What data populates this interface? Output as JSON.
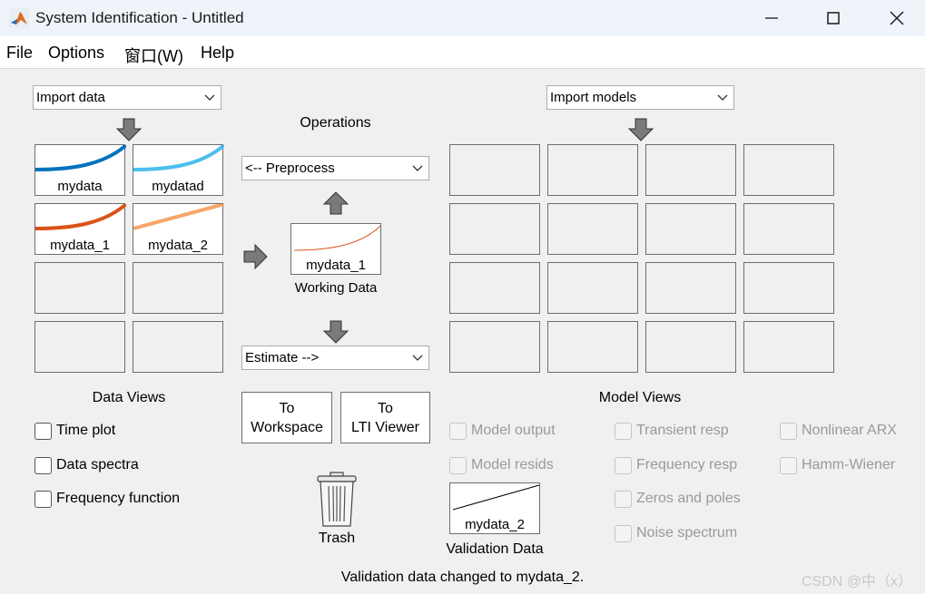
{
  "window": {
    "title": "System Identification - Untitled",
    "minimize_icon": "minimize-icon",
    "maximize_icon": "maximize-icon",
    "close_icon": "close-icon"
  },
  "menu": [
    "File",
    "Options",
    "窗口(W)",
    "Help"
  ],
  "data_panel": {
    "import_dropdown": "Import data",
    "tiles": [
      {
        "label": "mydata",
        "color": "#0072bd"
      },
      {
        "label": "mydatad",
        "color": "#4dbeee"
      },
      {
        "label": "mydata_1",
        "color": "#d95319"
      },
      {
        "label": "mydata_2",
        "color": "#f5a66a"
      }
    ],
    "section_label": "Data Views",
    "views": [
      "Time plot",
      "Data spectra",
      "Frequency function"
    ]
  },
  "operations": {
    "title": "Operations",
    "preprocess_dropdown": "<-- Preprocess",
    "working_data": {
      "label": "mydata_1",
      "caption": "Working Data",
      "color": "#d95319"
    },
    "estimate_dropdown": "Estimate -->",
    "to_workspace": [
      "To",
      "Workspace"
    ],
    "to_lti_viewer": [
      "To",
      "LTI Viewer"
    ],
    "trash_label": "Trash",
    "validation_data": {
      "label": "mydata_2",
      "caption": "Validation Data"
    }
  },
  "model_panel": {
    "import_dropdown": "Import models",
    "section_label": "Model Views",
    "views_col1": [
      "Model output",
      "Model resids"
    ],
    "views_col2": [
      "Transient resp",
      "Frequency resp",
      "Zeros and poles",
      "Noise spectrum"
    ],
    "views_col3": [
      "Nonlinear ARX",
      "Hamm-Wiener"
    ]
  },
  "status": "Validation data changed to mydata_2.",
  "watermark": "CSDN @中（x）"
}
